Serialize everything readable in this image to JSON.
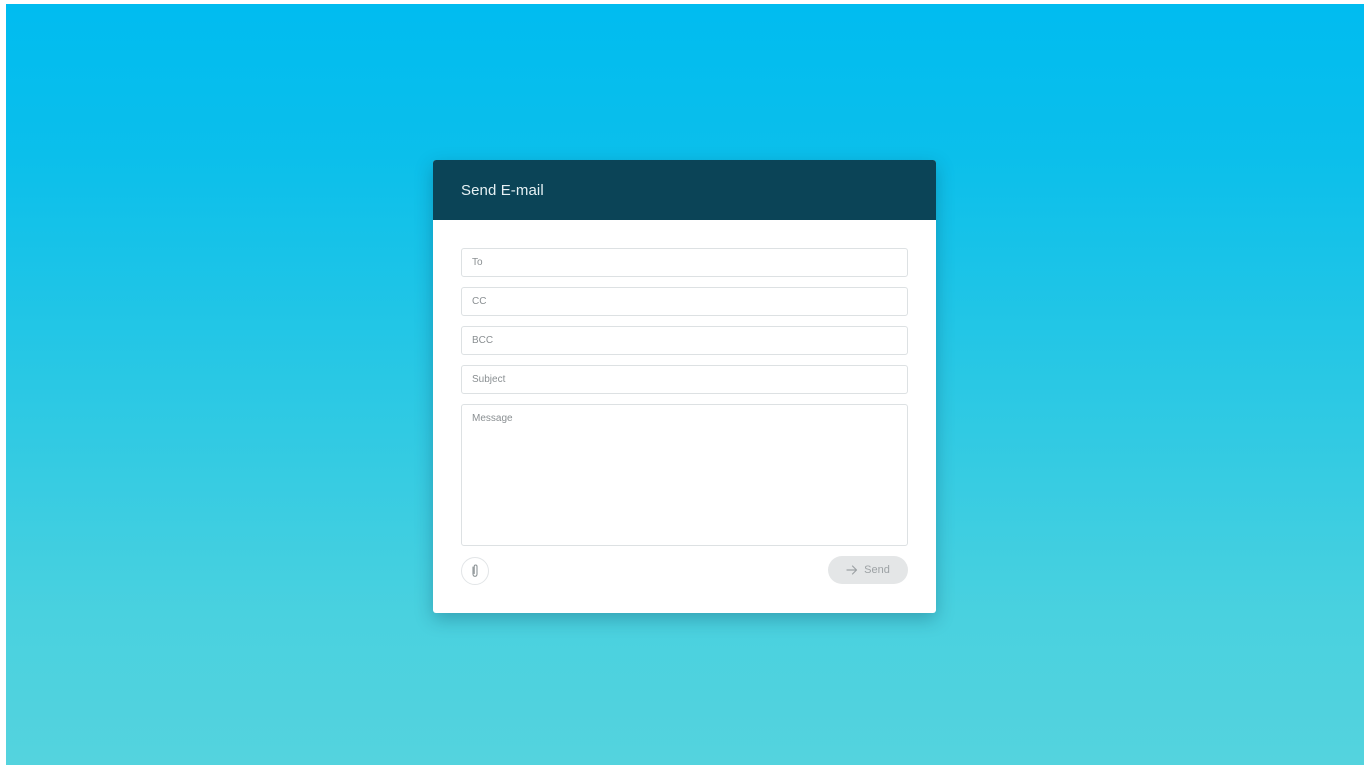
{
  "card": {
    "title": "Send E-mail"
  },
  "form": {
    "to_placeholder": "To",
    "cc_placeholder": "CC",
    "bcc_placeholder": "BCC",
    "subject_placeholder": "Subject",
    "message_placeholder": "Message",
    "to_value": "",
    "cc_value": "",
    "bcc_value": "",
    "subject_value": "",
    "message_value": ""
  },
  "actions": {
    "attach_icon": "paperclip-icon",
    "send_icon": "arrow-right-icon",
    "send_label": "Send"
  },
  "colors": {
    "header_bg": "#0b4457",
    "background_top": "#00bcf0",
    "background_bottom": "#54d3de",
    "send_button_bg": "#e4e6e7"
  }
}
